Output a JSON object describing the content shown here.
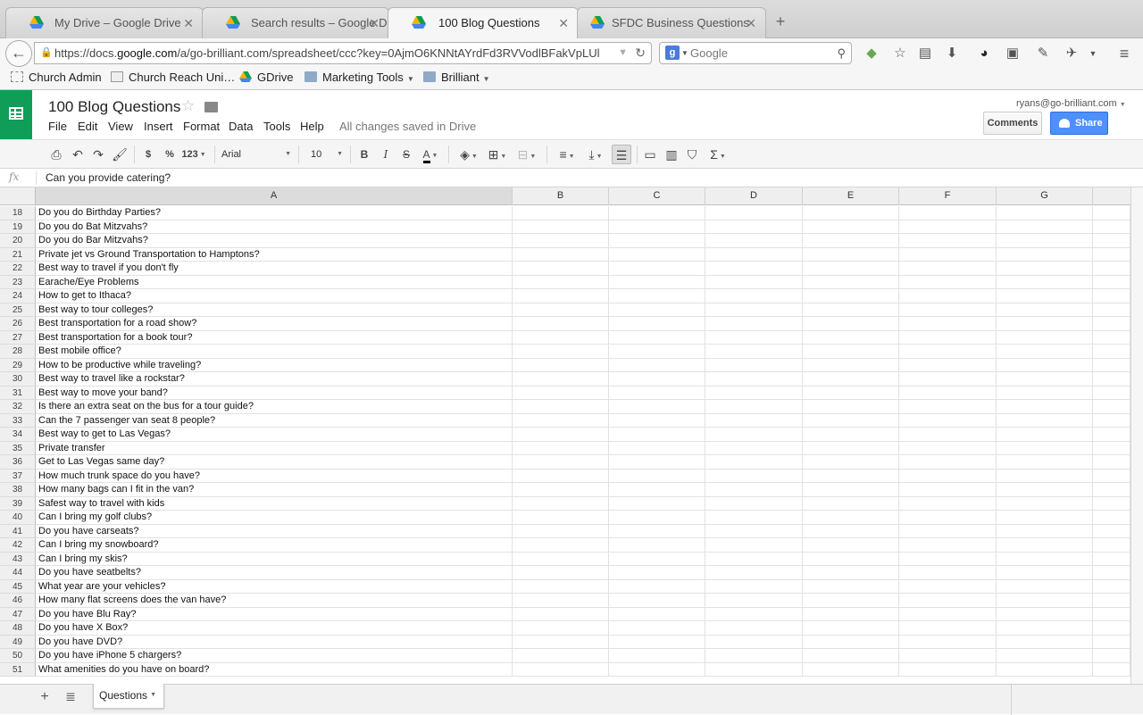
{
  "browser": {
    "tabs": [
      {
        "label": "My Drive – Google Drive",
        "active": false
      },
      {
        "label": "Search results – Google D…",
        "active": false
      },
      {
        "label": "100 Blog Questions",
        "active": true
      },
      {
        "label": "SFDC Business Questions",
        "active": false
      }
    ],
    "new_tab": "+",
    "url_prefix": "https://docs.",
    "url_domain": "google.com",
    "url_rest": "/a/go-brilliant.com/spreadsheet/ccc?key=0AjmO6KNNtAYrdFd3RVVodlBFakVpLUl",
    "search_placeholder": "Google",
    "bookmarks": [
      {
        "label": "Church Admin",
        "icon": "dashed-box-icon"
      },
      {
        "label": "Church Reach Uni…",
        "icon": "page-icon"
      },
      {
        "label": "GDrive",
        "icon": "drive-icon"
      },
      {
        "label": "Marketing Tools",
        "icon": "folder-icon",
        "dropdown": true
      },
      {
        "label": "Brilliant",
        "icon": "folder-icon",
        "dropdown": true
      }
    ]
  },
  "doc": {
    "title": "100 Blog Questions",
    "menus": [
      "File",
      "Edit",
      "View",
      "Insert",
      "Format",
      "Data",
      "Tools",
      "Help"
    ],
    "save_status": "All changes saved in Drive",
    "user_email": "ryans@go-brilliant.com",
    "comments_label": "Comments",
    "share_label": "Share",
    "brand_color": "#0f9d58",
    "share_color": "#4d90fe"
  },
  "toolbar": {
    "currency": "$",
    "percent": "%",
    "more_formats": "123",
    "font": "Arial",
    "font_size": "10",
    "bold": "B",
    "italic": "I",
    "strike": "S",
    "text_color": "A",
    "sum": "Σ"
  },
  "formula": {
    "fx": "fx",
    "value": "Can you provide catering?"
  },
  "grid": {
    "columns": [
      "A",
      "B",
      "C",
      "D",
      "E",
      "F",
      "G"
    ],
    "selected_column": "A",
    "rows": [
      {
        "num": "18",
        "a": "Do you do Birthday Parties?"
      },
      {
        "num": "19",
        "a": "Do you do Bat Mitzvahs?"
      },
      {
        "num": "20",
        "a": "Do you do Bar Mitzvahs?"
      },
      {
        "num": "21",
        "a": "Private jet vs Ground Transportation to Hamptons?"
      },
      {
        "num": "22",
        "a": "Best way to travel if you don't fly"
      },
      {
        "num": "23",
        "a": "Earache/Eye Problems"
      },
      {
        "num": "24",
        "a": "How to get to Ithaca?"
      },
      {
        "num": "25",
        "a": "Best way to tour colleges?"
      },
      {
        "num": "26",
        "a": "Best transportation for a road show?"
      },
      {
        "num": "27",
        "a": "Best transportation for a book tour?"
      },
      {
        "num": "28",
        "a": "Best mobile office?"
      },
      {
        "num": "29",
        "a": "How to be productive while traveling?"
      },
      {
        "num": "30",
        "a": "Best way to travel like a rockstar?"
      },
      {
        "num": "31",
        "a": "Best way to move your band?"
      },
      {
        "num": "32",
        "a": "Is there an extra seat on the bus for a tour guide?"
      },
      {
        "num": "33",
        "a": "Can the 7 passenger van seat 8 people?"
      },
      {
        "num": "34",
        "a": "Best way to get to Las Vegas?"
      },
      {
        "num": "35",
        "a": "Private transfer"
      },
      {
        "num": "36",
        "a": "Get to Las Vegas same day?"
      },
      {
        "num": "37",
        "a": "How much trunk space do you have?"
      },
      {
        "num": "38",
        "a": "How many bags can I fit in the van?"
      },
      {
        "num": "39",
        "a": "Safest way to travel with kids"
      },
      {
        "num": "40",
        "a": "Can I bring my golf clubs?"
      },
      {
        "num": "41",
        "a": "Do you have carseats?"
      },
      {
        "num": "42",
        "a": "Can I bring my snowboard?"
      },
      {
        "num": "43",
        "a": "Can I bring my skis?"
      },
      {
        "num": "44",
        "a": "Do you have seatbelts?"
      },
      {
        "num": "45",
        "a": "What year are your vehicles?"
      },
      {
        "num": "46",
        "a": "How many flat screens does the van have?"
      },
      {
        "num": "47",
        "a": "Do you have Blu Ray?"
      },
      {
        "num": "48",
        "a": "Do you have X Box?"
      },
      {
        "num": "49",
        "a": "Do you have DVD?"
      },
      {
        "num": "50",
        "a": "Do you have iPhone 5 chargers?"
      },
      {
        "num": "51",
        "a": "What amenities do you have on board?"
      }
    ]
  },
  "sheets": {
    "add": "+",
    "list": "≣",
    "active_sheet": "Questions"
  }
}
